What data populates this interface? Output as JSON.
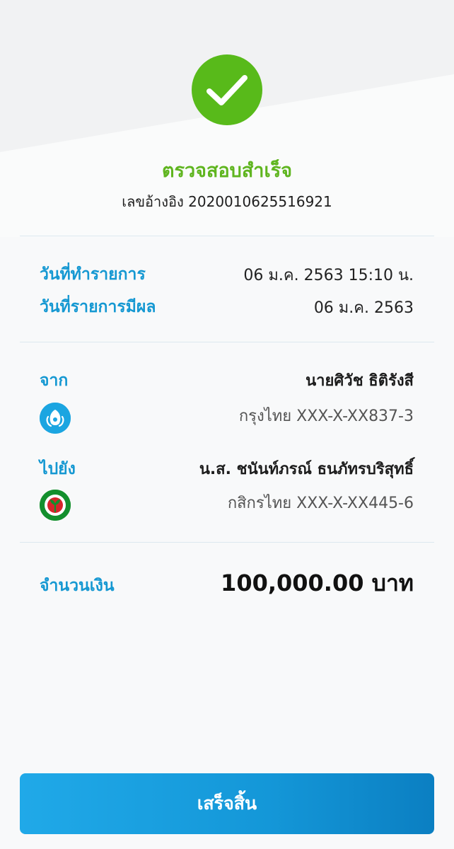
{
  "status": {
    "title": "ตรวจสอบสำเร็จ",
    "reference": "เลขอ้างอิง 2020010625516921",
    "success_color": "#58ba1a",
    "icon": "check-icon"
  },
  "transaction": {
    "date_label": "วันที่ทำรายการ",
    "date_value": "06 ม.ค. 2563 15:10 น.",
    "effective_label": "วันที่รายการมีผล",
    "effective_value": "06 ม.ค. 2563"
  },
  "sender": {
    "label": "จาก",
    "name": "นายศิวัช ธิติรังสี",
    "account": "กรุงไทย XXX-X-XX837-3",
    "bank_icon": "krungthai-bank-icon",
    "bank_color": "#1ba5e1"
  },
  "recipient": {
    "label": "ไปยัง",
    "name": "น.ส. ชนันท์ภรณ์ ธนภัทรบริสุทธิ์",
    "account": "กสิกรไทย XXX-X-XX445-6",
    "bank_icon": "kasikorn-bank-icon",
    "bank_color": "#138f2d"
  },
  "amount": {
    "label": "จำนวนเงิน",
    "value": "100,000.00 บาท"
  },
  "actions": {
    "done_label": "เสร็จสิ้น",
    "accent_color": "#1ba3e3"
  }
}
